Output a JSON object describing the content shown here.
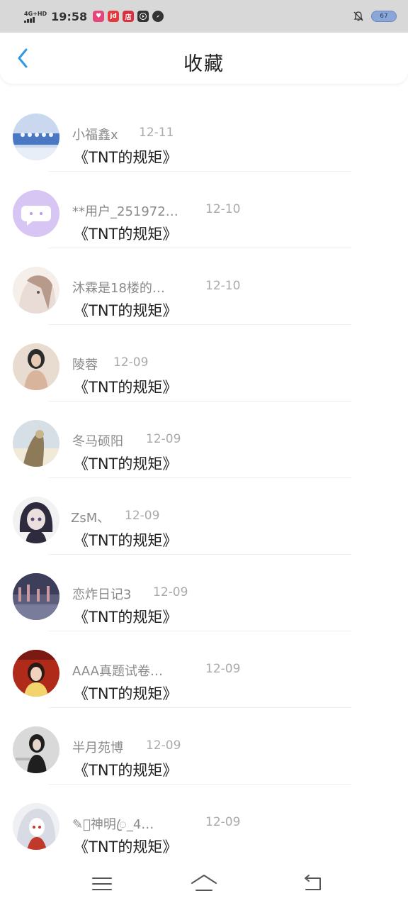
{
  "status_bar": {
    "network": "4G+HD",
    "time": "19:58",
    "app_icons": [
      {
        "label": "",
        "color": "#e4457a"
      },
      {
        "label": "jd",
        "color": "#e4393c"
      },
      {
        "label": "店",
        "color": "#d63041"
      },
      {
        "label": "",
        "color": "#333333"
      },
      {
        "label": "",
        "color": "#333333"
      }
    ],
    "battery": "67"
  },
  "header": {
    "title": "收藏"
  },
  "items": [
    {
      "name": "小福鑫x",
      "date": "12-11",
      "subject": "《TNT的规矩》",
      "avatar_colors": [
        "#c9d8ee",
        "#4a78c2",
        "#f4f6fa"
      ]
    },
    {
      "name": "**用户_251972…",
      "date": "12-10",
      "subject": "《TNT的规矩》",
      "avatar_colors": [
        "#d7c5f3",
        "#ffffff",
        "#b89ee8"
      ]
    },
    {
      "name": "沐霖是18楼的…",
      "date": "12-10",
      "subject": "《TNT的规矩》",
      "avatar_colors": [
        "#e9dcd6",
        "#b89a8a",
        "#f6efe9"
      ]
    },
    {
      "name": "陵蓉",
      "date": "12-09",
      "subject": "《TNT的规矩》",
      "avatar_colors": [
        "#e7dccf",
        "#2b2b2b",
        "#d9b49c"
      ]
    },
    {
      "name": "冬马硕阳",
      "date": "12-09",
      "subject": "《TNT的规矩》",
      "avatar_colors": [
        "#d7dfe6",
        "#8d7a59",
        "#f1ead9"
      ]
    },
    {
      "name": "ZsM、",
      "date": "12-09",
      "subject": "《TNT的规矩》",
      "avatar_colors": [
        "#f2f2f2",
        "#2d2b3d",
        "#ece0de"
      ]
    },
    {
      "name": "恋炸日记3",
      "date": "12-09",
      "subject": "《TNT的规矩》",
      "avatar_colors": [
        "#5d5e7c",
        "#c99aa0",
        "#3c3e5a"
      ]
    },
    {
      "name": "AAA真题试卷…",
      "date": "12-09",
      "subject": "《TNT的规矩》",
      "avatar_colors": [
        "#b02a1a",
        "#f3d36b",
        "#7b1a12"
      ]
    },
    {
      "name": "半月苑博",
      "date": "12-09",
      "subject": "《TNT的规矩》",
      "avatar_colors": [
        "#d9d9d9",
        "#1f1f1f",
        "#b8b8b8"
      ]
    },
    {
      "name": "✎᭄神明ꦿ_4…",
      "date": "12-09",
      "subject": "《TNT的规矩》",
      "avatar_colors": [
        "#eef0f4",
        "#c0392b",
        "#ffffff"
      ]
    }
  ]
}
